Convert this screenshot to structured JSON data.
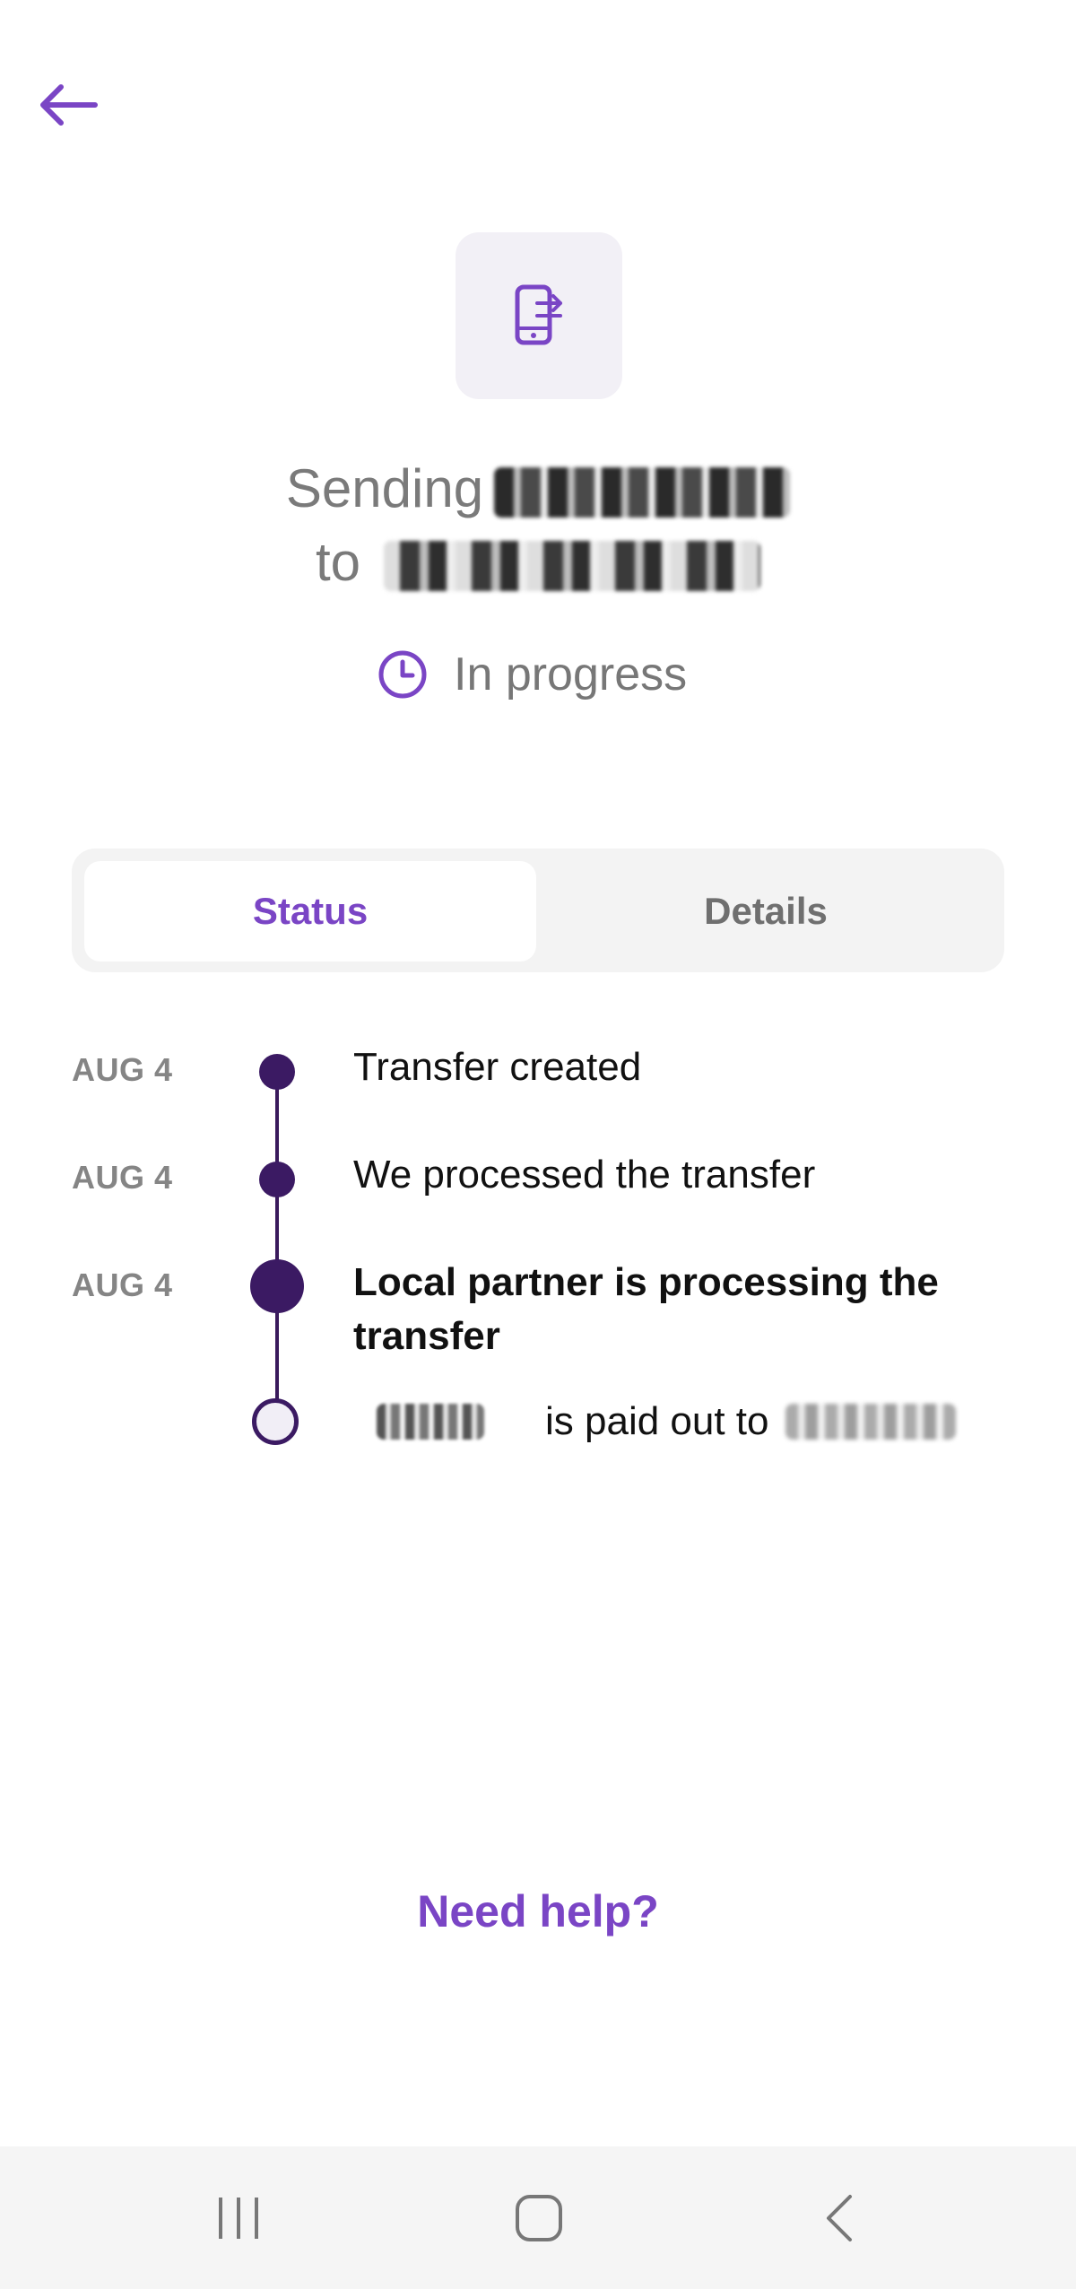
{
  "header": {
    "back_icon": "arrow-left-icon"
  },
  "transfer": {
    "icon": "mobile-transfer-icon",
    "sending_label": "Sending",
    "to_label": "to",
    "status_icon": "clock-icon",
    "status_text": "In progress"
  },
  "tabs": [
    {
      "label": "Status",
      "selected": true
    },
    {
      "label": "Details",
      "selected": false
    }
  ],
  "timeline": [
    {
      "date": "AUG 4",
      "text": "Transfer created",
      "state": "done"
    },
    {
      "date": "AUG 4",
      "text": "We processed the transfer",
      "state": "done"
    },
    {
      "date": "AUG 4",
      "text": "Local partner is processing the transfer",
      "state": "current"
    },
    {
      "date": "",
      "text_middle": "is paid out to",
      "state": "pending"
    }
  ],
  "help": {
    "label": "Need help?"
  },
  "navbar": {
    "recent_icon": "recent-apps-icon",
    "home_icon": "home-icon",
    "back_icon": "chevron-left-icon"
  },
  "colors": {
    "accent": "#7a45c5",
    "timeline_dark": "#3b1a63",
    "muted_text": "#7a7a7a"
  }
}
